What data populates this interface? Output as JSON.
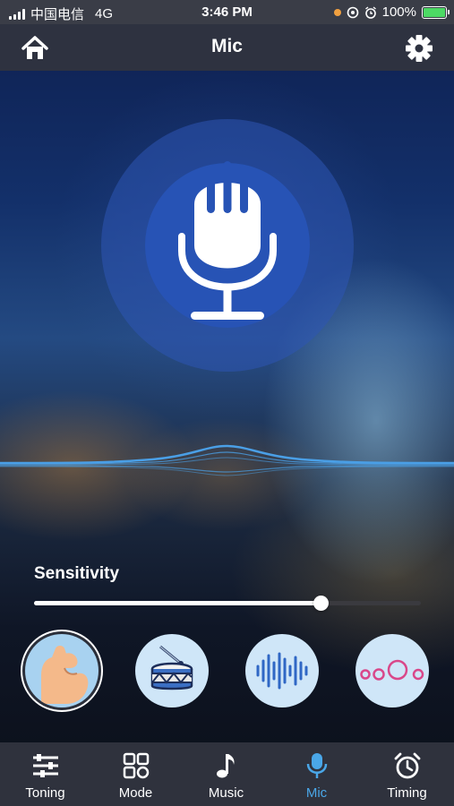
{
  "status_bar": {
    "carrier": "中国电信",
    "network": "4G",
    "time": "3:46 PM",
    "battery": "100%",
    "icons": [
      "signal-icon",
      "orange-dot-icon",
      "location-lock-icon",
      "alarm-icon",
      "battery-charging-icon"
    ]
  },
  "header": {
    "title": "Mic",
    "left_icon": "home-icon",
    "right_icon": "gear-icon"
  },
  "mic": {
    "icon": "microphone-icon"
  },
  "sensitivity": {
    "label": "Sensitivity",
    "value": 0.74
  },
  "modes": [
    {
      "name": "muscle-mode",
      "icon": "flexed-arm-icon",
      "selected": true
    },
    {
      "name": "drum-mode",
      "icon": "drum-icon",
      "selected": false
    },
    {
      "name": "soundwave-mode",
      "icon": "sound-wave-icon",
      "selected": false
    },
    {
      "name": "bubbles-mode",
      "icon": "circles-icon",
      "selected": false
    }
  ],
  "tabs": [
    {
      "label": "Toning",
      "icon": "sliders-icon",
      "active": false
    },
    {
      "label": "Mode",
      "icon": "grid-icon",
      "active": false
    },
    {
      "label": "Music",
      "icon": "music-note-icon",
      "active": false
    },
    {
      "label": "Mic",
      "icon": "microphone-icon",
      "active": true
    },
    {
      "label": "Timing",
      "icon": "alarm-clock-icon",
      "active": false
    }
  ],
  "colors": {
    "active_tab": "#4aa7e8",
    "bar_background": "#2f323d",
    "mic_circle": "#2753b5",
    "wave": "#4a9fe6"
  }
}
